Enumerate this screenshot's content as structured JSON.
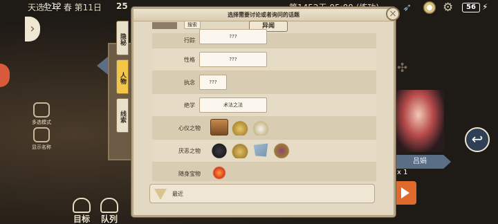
{
  "status_bar": {
    "clock": "4:12",
    "date_text": "天选之年 春 第11日",
    "count": "25",
    "right_text": "第1452天 05:00 (练功)",
    "battery": "56"
  },
  "dialog": {
    "title": "选择需要讨论或者询问的话题",
    "close": "×"
  },
  "tabs": [
    {
      "label": "隐秘",
      "active": false
    },
    {
      "label": "人物",
      "active": true
    },
    {
      "label": "线索",
      "active": false
    }
  ],
  "search": {
    "label": "搜索"
  },
  "section": {
    "title": "异闻"
  },
  "rows": [
    {
      "label": "行踪",
      "value": "???"
    },
    {
      "label": "性格",
      "value": "???"
    },
    {
      "label": "执念",
      "value": "???"
    },
    {
      "label": "绝学",
      "value": "术法之法"
    },
    {
      "label": "心仪之物",
      "items": [
        "chest-icon",
        "gold-ingot-icon",
        "silver-ore-icon"
      ]
    },
    {
      "label": "厌恶之物",
      "items": [
        "ink-stone-icon",
        "gold-pile-icon",
        "cloth-icon",
        "fruit-bowl-icon"
      ]
    },
    {
      "label": "随身宝物",
      "items": [
        "red-orb-icon"
      ]
    }
  ],
  "recent": {
    "label": "最近"
  },
  "left_side": {
    "action1": "多选模式",
    "action2": "显示名称"
  },
  "bottom": {
    "target": "目标",
    "team": "队列"
  },
  "right_side": {
    "name_tag": "吕娟",
    "multiplier": "x 1"
  }
}
